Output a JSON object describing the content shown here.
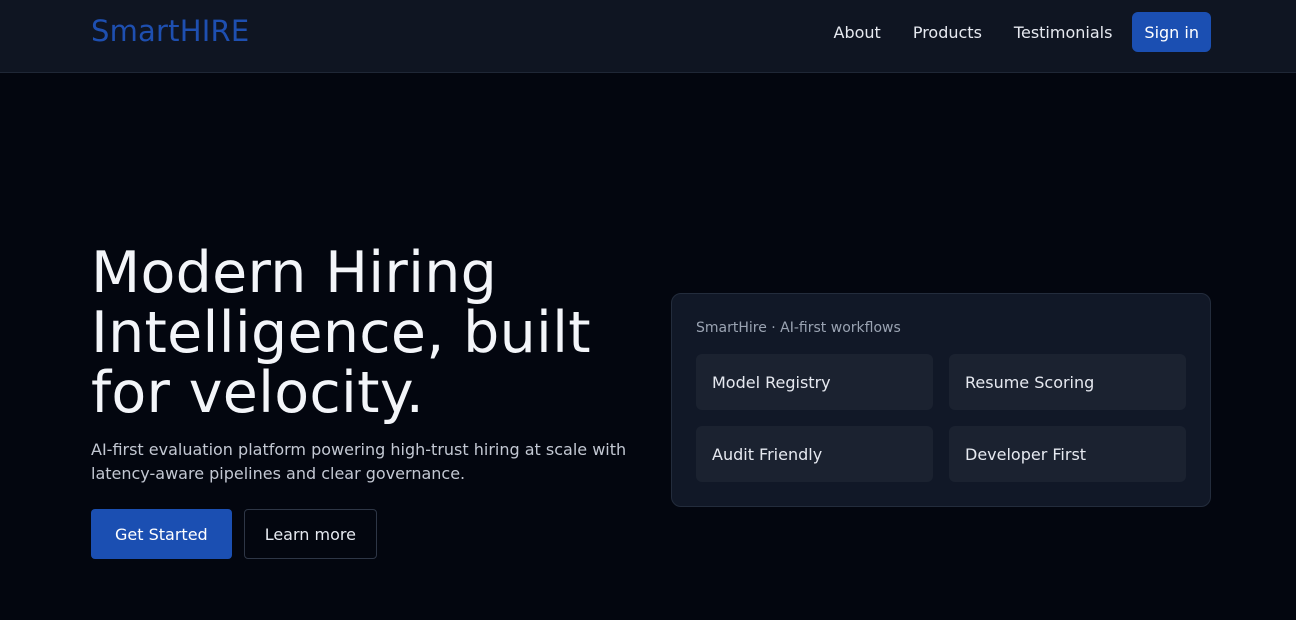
{
  "header": {
    "brand": "SmartHIRE",
    "nav": [
      {
        "label": "About"
      },
      {
        "label": "Products"
      },
      {
        "label": "Testimonials"
      }
    ],
    "sign_in_label": "Sign in"
  },
  "hero": {
    "title": "Modern Hiring Intelligence, built for velocity.",
    "subtitle": "AI-first evaluation platform powering high-trust hiring at scale with latency-aware pipelines and clear governance.",
    "primary_cta": "Get Started",
    "secondary_cta": "Learn more"
  },
  "panel": {
    "caption": "SmartHire · AI-first workflows",
    "features": [
      {
        "label": "Model Registry"
      },
      {
        "label": "Resume Scoring"
      },
      {
        "label": "Audit Friendly"
      },
      {
        "label": "Developer First"
      }
    ]
  },
  "colors": {
    "background": "#03060f",
    "navbar": "#0f1522",
    "accent": "#1b4fb2",
    "panel": "#111827",
    "card": "#1b2230"
  }
}
